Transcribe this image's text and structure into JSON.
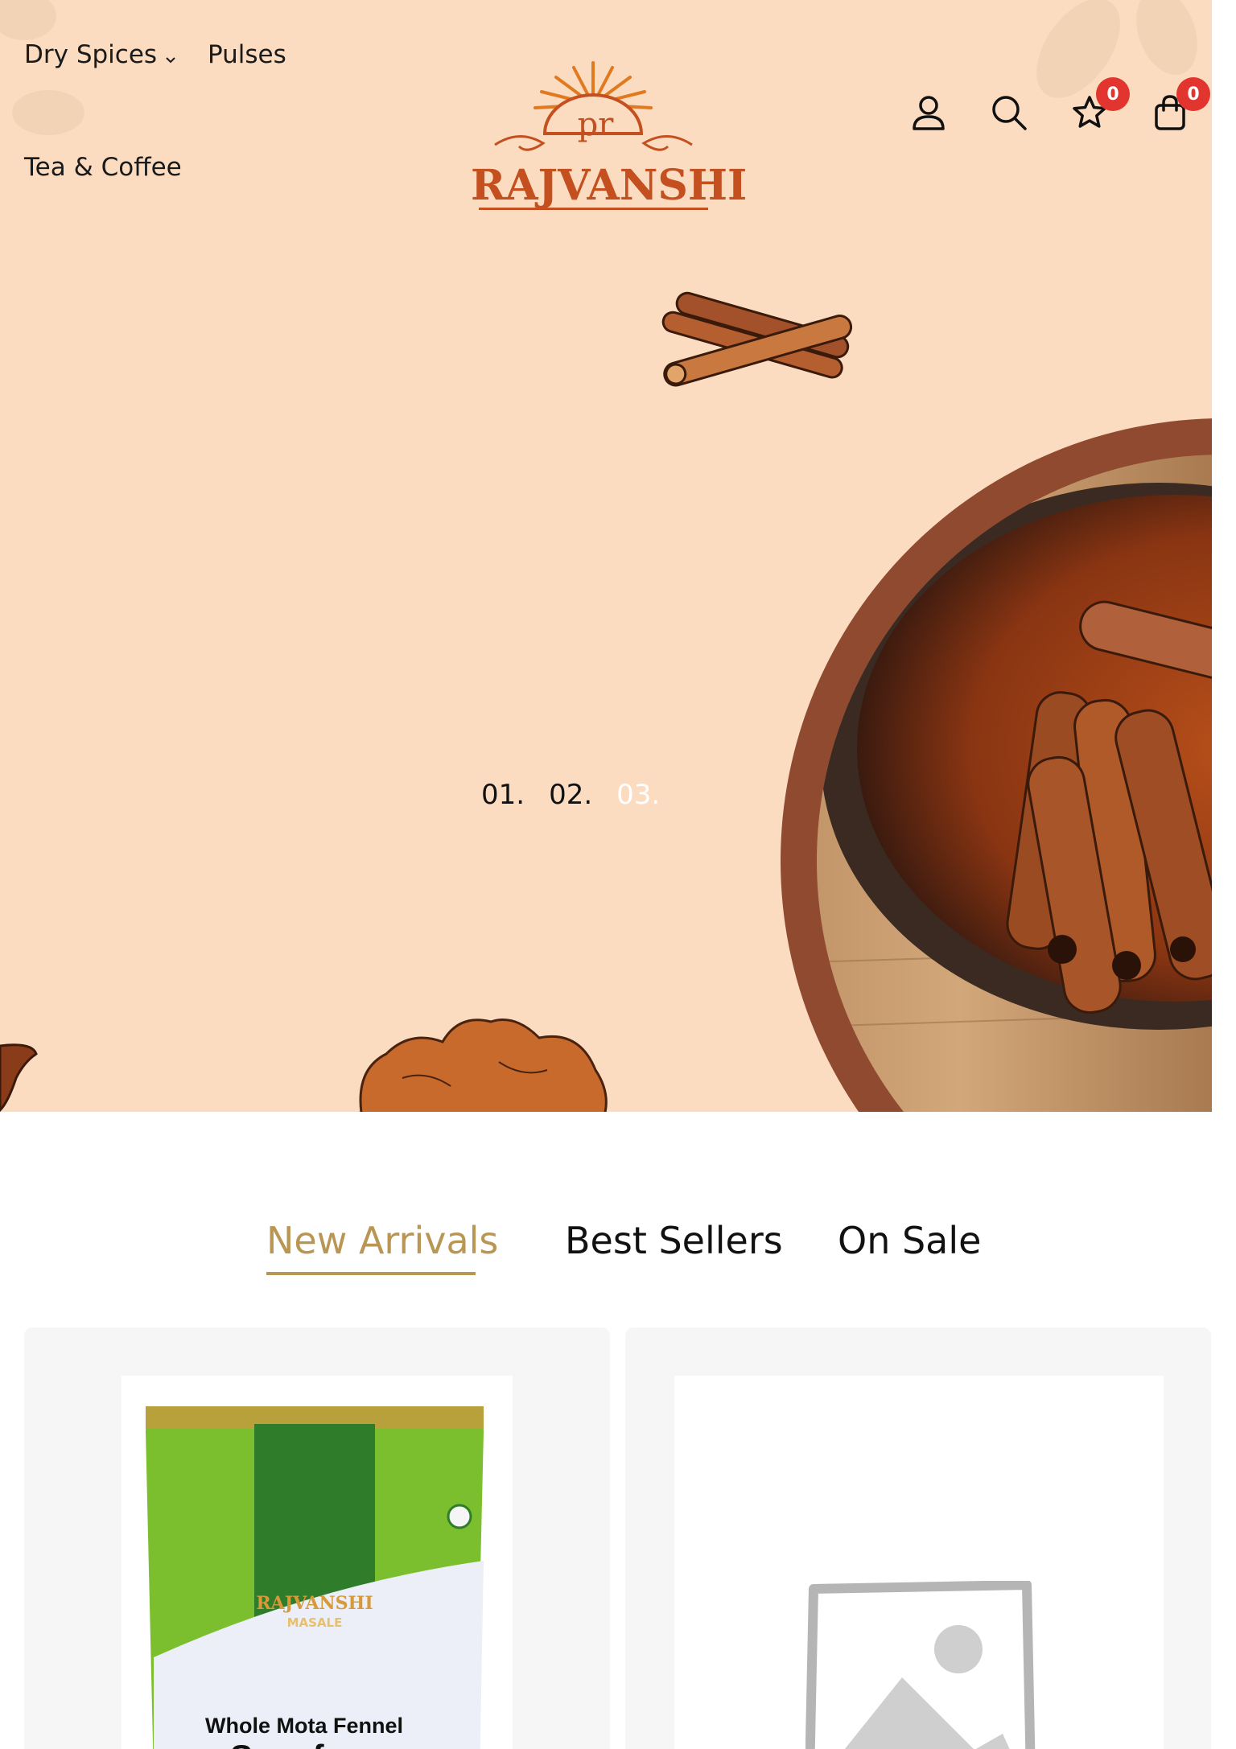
{
  "header": {
    "nav": {
      "dry_spices": "Dry Spices",
      "pulses": "Pulses",
      "tea_coffee": "Tea & Coffee"
    },
    "logo": {
      "initials": "pr",
      "wordmark": "RAJVANSHI"
    },
    "wishlist_count": "0",
    "cart_count": "0"
  },
  "hero": {
    "slides": [
      "01.",
      "02.",
      "03."
    ],
    "active_slide": 3
  },
  "tabs": {
    "items": [
      "New Arrivals",
      "Best Sellers",
      "On Sale"
    ],
    "active": "New Arrivals"
  },
  "products": [
    {
      "package": {
        "brand": "RAJVANSHI",
        "sub": "MASALE",
        "line1": "Whole Mota Fennel",
        "line2": "Snauf"
      }
    },
    {
      "image": "placeholder-image-icon"
    }
  ],
  "colors": {
    "hero_bg": "#fbdcc0",
    "brand": "#c4501f",
    "accent": "#b99654",
    "badge": "#e2352f",
    "card_bg": "#f6f6f6"
  }
}
